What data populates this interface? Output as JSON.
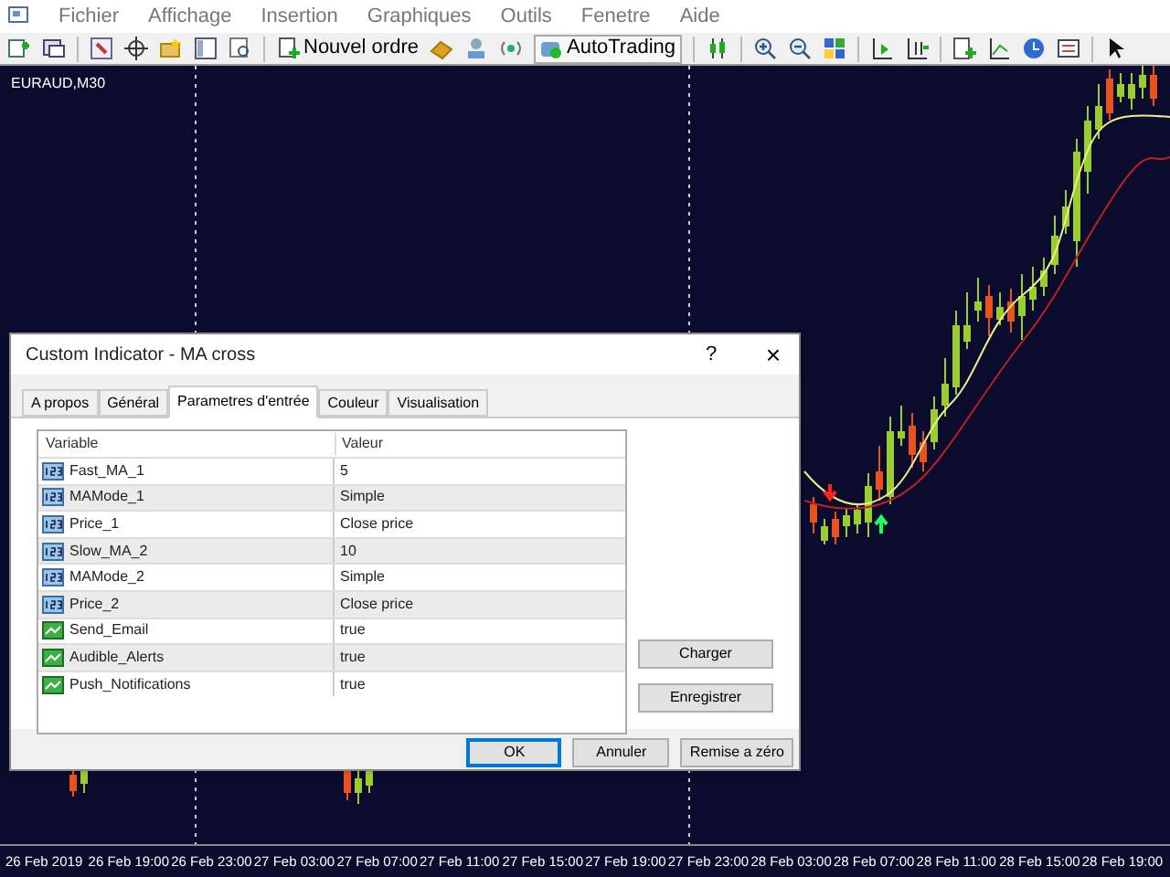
{
  "menu": [
    "Fichier",
    "Affichage",
    "Insertion",
    "Graphiques",
    "Outils",
    "Fenetre",
    "Aide"
  ],
  "toolbar": {
    "new_order": "Nouvel ordre",
    "autotrading": "AutoTrading"
  },
  "chart": {
    "symbol": "EURAUD,M30",
    "time_labels": [
      "26 Feb 2019",
      "26 Feb 19:00",
      "26 Feb 23:00",
      "27 Feb 03:00",
      "27 Feb 07:00",
      "27 Feb 11:00",
      "27 Feb 15:00",
      "27 Feb 19:00",
      "27 Feb 23:00",
      "28 Feb 03:00",
      "28 Feb 07:00",
      "28 Feb 11:00",
      "28 Feb 15:00",
      "28 Feb 19:00"
    ]
  },
  "dialog": {
    "title": "Custom Indicator - MA cross",
    "help": "?",
    "close": "×",
    "tabs": [
      {
        "label": "A propos",
        "selected": false
      },
      {
        "label": "Général",
        "selected": false
      },
      {
        "label": "Parametres d'entrée",
        "selected": true
      },
      {
        "label": "Couleur",
        "selected": false
      },
      {
        "label": "Visualisation",
        "selected": false
      }
    ],
    "table": {
      "columns": [
        "Variable",
        "Valeur"
      ],
      "rows": [
        {
          "kind": "number",
          "variable": "Fast_MA_1",
          "value": "5"
        },
        {
          "kind": "number",
          "variable": "MAMode_1",
          "value": "Simple"
        },
        {
          "kind": "number",
          "variable": "Price_1",
          "value": "Close price"
        },
        {
          "kind": "number",
          "variable": "Slow_MA_2",
          "value": "10"
        },
        {
          "kind": "number",
          "variable": "MAMode_2",
          "value": "Simple"
        },
        {
          "kind": "number",
          "variable": "Price_2",
          "value": "Close price"
        },
        {
          "kind": "bool",
          "variable": "Send_Email",
          "value": "true"
        },
        {
          "kind": "bool",
          "variable": "Audible_Alerts",
          "value": "true"
        },
        {
          "kind": "bool",
          "variable": "Push_Notifications",
          "value": "true"
        }
      ]
    },
    "side_buttons": [
      "Charger",
      "Enregistrer"
    ],
    "buttons": [
      {
        "label": "OK",
        "default": true
      },
      {
        "label": "Annuler",
        "default": false
      },
      {
        "label": "Remise a zéro",
        "default": false
      }
    ]
  }
}
